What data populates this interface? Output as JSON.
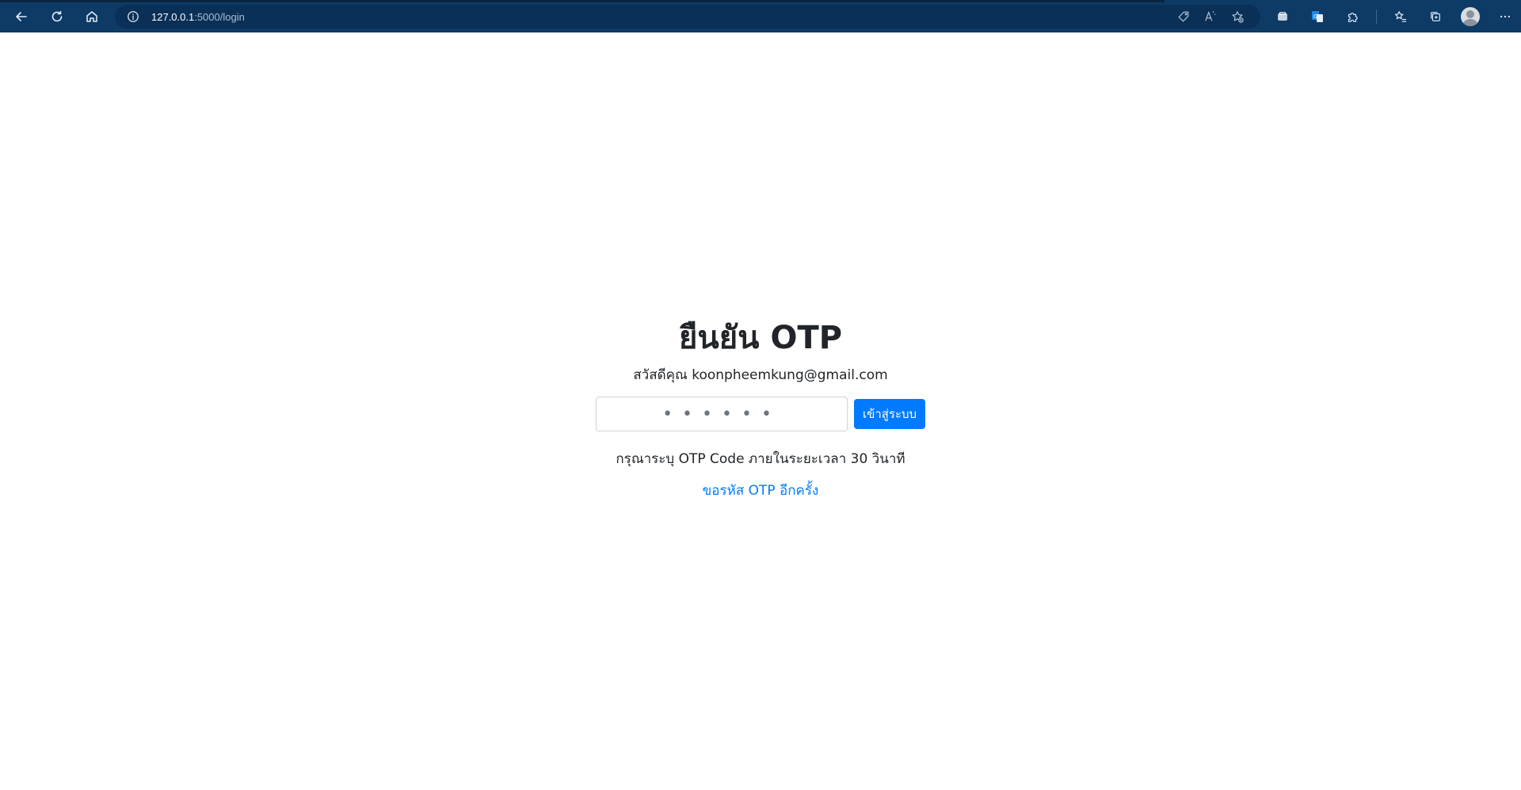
{
  "browser": {
    "url_host": "127.0.0.1",
    "url_path": ":5000/login"
  },
  "otp_page": {
    "title": "ยืนยัน OTP",
    "greeting": "สวัสดีคุณ koonpheemkung@gmail.com",
    "input_placeholder": "••••••",
    "login_label": "เข้าสู่ระบบ",
    "hint": "กรุณาระบุ OTP Code ภายในระยะเวลา 30 วินาที",
    "resend_label": "ขอรหัส OTP อีกครั้ง"
  },
  "colors": {
    "browser_bar": "#0d3b66",
    "primary": "#007bff",
    "text": "#212529"
  }
}
